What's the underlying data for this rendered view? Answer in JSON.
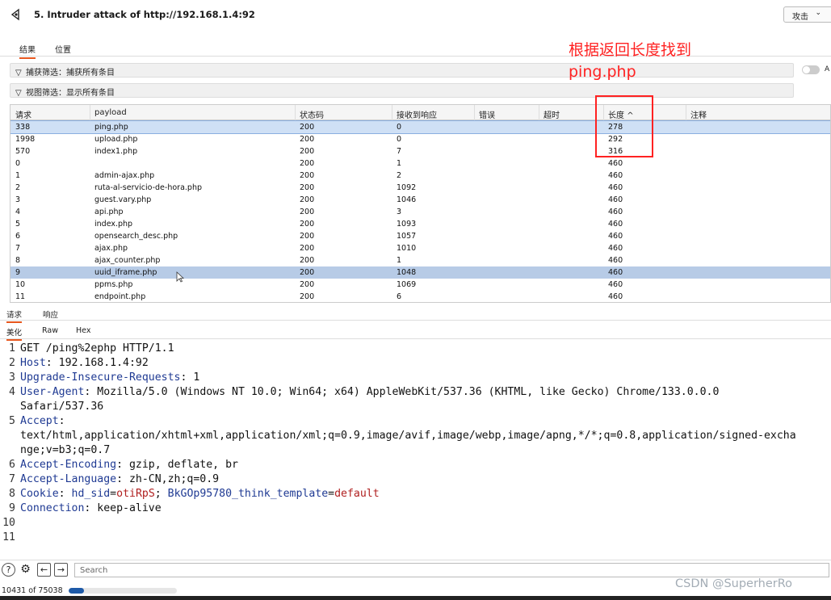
{
  "window": {
    "title": "5. Intruder attack of http://192.168.1.4:92",
    "attack_menu": "攻击"
  },
  "tabs": [
    "结果",
    "位置"
  ],
  "filters": {
    "capture": "捕获筛选：捕获所有条目",
    "view": "视图筛选：显示所有条目",
    "toggle_label": "A"
  },
  "annotation": {
    "line1": "根据返回长度找到",
    "line2": "ping.php",
    "color": "#ff2222"
  },
  "table": {
    "columns": [
      "请求",
      "payload",
      "状态码",
      "接收到响应",
      "错误",
      "超时",
      "长度",
      "注释"
    ],
    "sort_indicator": "^",
    "rows": [
      {
        "req": "338",
        "payload": "ping.php",
        "status": "200",
        "recv": "0",
        "len": "278"
      },
      {
        "req": "1998",
        "payload": "upload.php",
        "status": "200",
        "recv": "0",
        "len": "292"
      },
      {
        "req": "570",
        "payload": "index1.php",
        "status": "200",
        "recv": "7",
        "len": "316"
      },
      {
        "req": "0",
        "payload": "",
        "status": "200",
        "recv": "1",
        "len": "460"
      },
      {
        "req": "1",
        "payload": "admin-ajax.php",
        "status": "200",
        "recv": "2",
        "len": "460"
      },
      {
        "req": "2",
        "payload": "ruta-al-servicio-de-hora.php",
        "status": "200",
        "recv": "1092",
        "len": "460"
      },
      {
        "req": "3",
        "payload": "guest.vary.php",
        "status": "200",
        "recv": "1046",
        "len": "460"
      },
      {
        "req": "4",
        "payload": "api.php",
        "status": "200",
        "recv": "3",
        "len": "460"
      },
      {
        "req": "5",
        "payload": "index.php",
        "status": "200",
        "recv": "1093",
        "len": "460"
      },
      {
        "req": "6",
        "payload": "opensearch_desc.php",
        "status": "200",
        "recv": "1057",
        "len": "460"
      },
      {
        "req": "7",
        "payload": "ajax.php",
        "status": "200",
        "recv": "1010",
        "len": "460"
      },
      {
        "req": "8",
        "payload": "ajax_counter.php",
        "status": "200",
        "recv": "1",
        "len": "460"
      },
      {
        "req": "9",
        "payload": "uuid_iframe.php",
        "status": "200",
        "recv": "1048",
        "len": "460"
      },
      {
        "req": "10",
        "payload": "ppms.php",
        "status": "200",
        "recv": "1069",
        "len": "460"
      },
      {
        "req": "11",
        "payload": "endpoint.php",
        "status": "200",
        "recv": "6",
        "len": "460"
      }
    ]
  },
  "request_tabs": [
    "请求",
    "响应"
  ],
  "view_tabs": [
    "美化",
    "Raw",
    "Hex"
  ],
  "editor": {
    "lines": [
      {
        "n": "1",
        "parts": [
          {
            "t": "GET /ping%2ephp HTTP/1.1",
            "c": ""
          }
        ]
      },
      {
        "n": "2",
        "parts": [
          {
            "t": "Host",
            "c": "k"
          },
          {
            "t": ": 192.168.1.4:92",
            "c": ""
          }
        ]
      },
      {
        "n": "3",
        "parts": [
          {
            "t": "Upgrade-Insecure-Requests",
            "c": "k"
          },
          {
            "t": ": 1",
            "c": ""
          }
        ]
      },
      {
        "n": "4",
        "parts": [
          {
            "t": "User-Agent",
            "c": "k"
          },
          {
            "t": ": Mozilla/5.0 (Windows NT 10.0; Win64; x64) AppleWebKit/537.36 (KHTML, like Gecko) Chrome/133.0.0.0",
            "c": ""
          }
        ]
      },
      {
        "n": "",
        "parts": [
          {
            "t": "Safari/537.36",
            "c": ""
          }
        ]
      },
      {
        "n": "5",
        "parts": [
          {
            "t": "Accept",
            "c": "k"
          },
          {
            "t": ":",
            "c": ""
          }
        ]
      },
      {
        "n": "",
        "parts": [
          {
            "t": "text/html,application/xhtml+xml,application/xml;q=0.9,image/avif,image/webp,image/apng,*/*;q=0.8,application/signed-excha",
            "c": ""
          }
        ]
      },
      {
        "n": "",
        "parts": [
          {
            "t": "nge;v=b3;q=0.7",
            "c": ""
          }
        ]
      },
      {
        "n": "6",
        "parts": [
          {
            "t": "Accept-Encoding",
            "c": "k"
          },
          {
            "t": ": gzip, deflate, br",
            "c": ""
          }
        ]
      },
      {
        "n": "7",
        "parts": [
          {
            "t": "Accept-Language",
            "c": "k"
          },
          {
            "t": ": zh-CN,zh;q=0.9",
            "c": ""
          }
        ]
      },
      {
        "n": "8",
        "parts": [
          {
            "t": "Cookie",
            "c": "k"
          },
          {
            "t": ": ",
            "c": ""
          },
          {
            "t": "hd_sid",
            "c": "ck"
          },
          {
            "t": "=",
            "c": ""
          },
          {
            "t": "otiRpS",
            "c": "cv"
          },
          {
            "t": "; ",
            "c": ""
          },
          {
            "t": "BkGOp95780_think_template",
            "c": "ck"
          },
          {
            "t": "=",
            "c": ""
          },
          {
            "t": "default",
            "c": "cv"
          }
        ]
      },
      {
        "n": "9",
        "parts": [
          {
            "t": "Connection",
            "c": "k"
          },
          {
            "t": ": keep-alive",
            "c": ""
          }
        ]
      },
      {
        "n": "10",
        "parts": []
      },
      {
        "n": "11",
        "parts": []
      }
    ]
  },
  "bottom": {
    "search_placeholder": "Search"
  },
  "status": {
    "count": "10431 of 75038",
    "progress_fraction": 0.139
  },
  "watermark": "CSDN @SuperherRo"
}
